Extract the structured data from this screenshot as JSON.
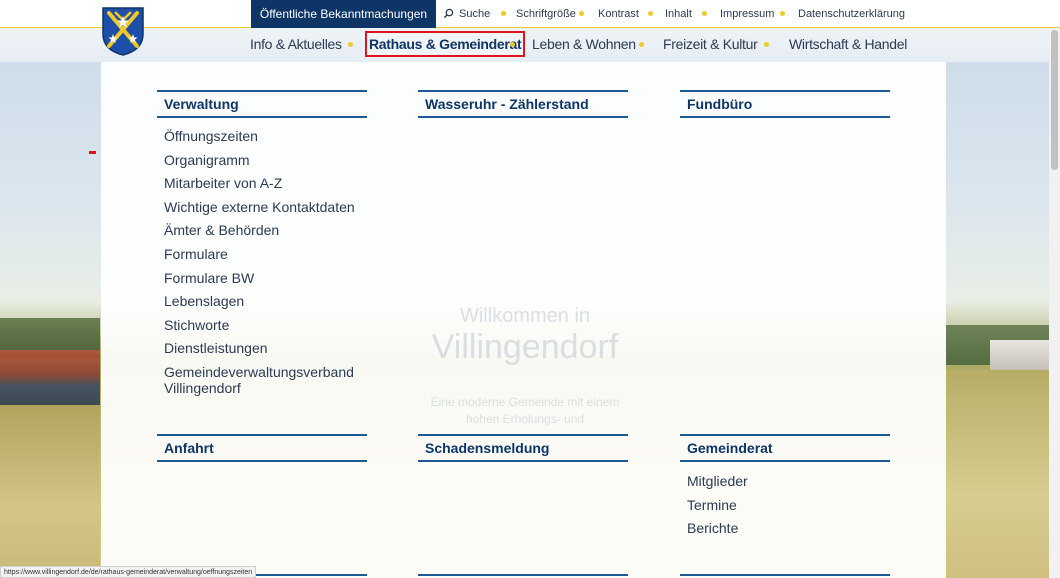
{
  "topbar": {
    "bekanntmachungen": "Öffentliche Bekanntmachungen",
    "utilities": [
      "Suche",
      "Schriftgröße",
      "Kontrast",
      "Inhalt",
      "Impressum",
      "Datenschutzerklärung"
    ]
  },
  "nav": {
    "items": [
      "Info & Aktuelles",
      "Rathaus & Gemeinderat",
      "Leben & Wohnen",
      "Freizeit & Kultur",
      "Wirtschaft & Handel"
    ],
    "active_index": 1
  },
  "mega": {
    "columns": [
      {
        "title": "Verwaltung",
        "items": [
          "Öffnungszeiten",
          "Organigramm",
          "Mitarbeiter von A-Z",
          "Wichtige externe Kontaktdaten",
          "Ämter & Behörden",
          "Formulare",
          "Formulare BW",
          "Lebenslagen",
          "Stichworte",
          "Dienstleistungen",
          "Gemeindeverwaltungsverband Villingendorf"
        ]
      },
      {
        "title": "Wasseruhr - Zählerstand",
        "items": []
      },
      {
        "title": "Fundbüro",
        "items": []
      },
      {
        "title": "Anfahrt",
        "items": []
      },
      {
        "title": "Schadensmeldung",
        "items": []
      },
      {
        "title": "Gemeinderat",
        "items": [
          "Mitglieder",
          "Termine",
          "Berichte"
        ]
      }
    ]
  },
  "welcome": {
    "line1": "Willkommen in",
    "line2": "Villingendorf",
    "line3": "Eine moderne Gemeinde mit einem",
    "line4": "hohen Erholungs- und"
  },
  "statusbar": {
    "url": "https://www.villingendorf.de/de/rathaus-gemeinderat/verwaltung/oeffnungszeiten"
  },
  "colors": {
    "navy": "#0d3566",
    "accent_yellow": "#f0c928",
    "rule_blue": "#1d5a94",
    "active_border": "#e0141e"
  }
}
